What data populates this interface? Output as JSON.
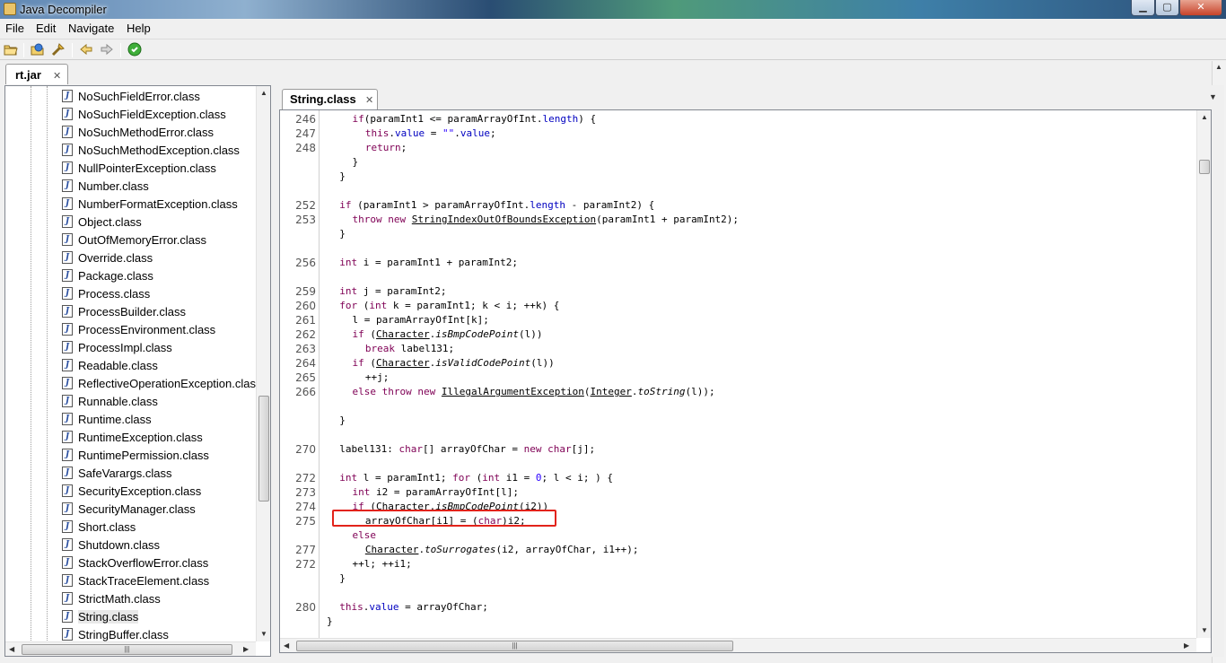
{
  "window": {
    "title": "Java Decompiler",
    "min_label": "▁",
    "max_label": "▢",
    "close_label": "✕"
  },
  "menu": [
    "File",
    "Edit",
    "Navigate",
    "Help"
  ],
  "toolbar": {
    "icons": [
      "open-file-icon",
      "open-type-icon",
      "open-type-hierarchy-icon",
      "back-icon",
      "forward-icon",
      "search-icon"
    ]
  },
  "outer_tab": {
    "label": "rt.jar",
    "close": "✕"
  },
  "inner_tab": {
    "label": "String.class",
    "close": "✕"
  },
  "tree": {
    "items": [
      "NoSuchFieldError.class",
      "NoSuchFieldException.class",
      "NoSuchMethodError.class",
      "NoSuchMethodException.class",
      "NullPointerException.class",
      "Number.class",
      "NumberFormatException.class",
      "Object.class",
      "OutOfMemoryError.class",
      "Override.class",
      "Package.class",
      "Process.class",
      "ProcessBuilder.class",
      "ProcessEnvironment.class",
      "ProcessImpl.class",
      "Readable.class",
      "ReflectiveOperationException.class",
      "Runnable.class",
      "Runtime.class",
      "RuntimeException.class",
      "RuntimePermission.class",
      "SafeVarargs.class",
      "SecurityException.class",
      "SecurityManager.class",
      "Short.class",
      "Shutdown.class",
      "StackOverflowError.class",
      "StackTraceElement.class",
      "StrictMath.class",
      "String.class",
      "StringBuffer.class"
    ],
    "selected": "String.class"
  },
  "code": {
    "lines": [
      {
        "n": "246",
        "indent": 4
      },
      {
        "n": "247",
        "indent": 6
      },
      {
        "n": "248",
        "indent": 6
      },
      {
        "n": "",
        "indent": 4
      },
      {
        "n": "",
        "indent": 2
      },
      {
        "n": "",
        "indent": 0
      },
      {
        "n": "252",
        "indent": 2
      },
      {
        "n": "253",
        "indent": 4
      },
      {
        "n": "",
        "indent": 2
      },
      {
        "n": "",
        "indent": 0
      },
      {
        "n": "256",
        "indent": 2
      },
      {
        "n": "",
        "indent": 0
      },
      {
        "n": "259",
        "indent": 2
      },
      {
        "n": "260",
        "indent": 2
      },
      {
        "n": "261",
        "indent": 4
      },
      {
        "n": "262",
        "indent": 4
      },
      {
        "n": "263",
        "indent": 6
      },
      {
        "n": "264",
        "indent": 4
      },
      {
        "n": "265",
        "indent": 6
      },
      {
        "n": "266",
        "indent": 4
      },
      {
        "n": "",
        "indent": 0
      },
      {
        "n": "",
        "indent": 2
      },
      {
        "n": "",
        "indent": 0
      },
      {
        "n": "270",
        "indent": 2
      },
      {
        "n": "",
        "indent": 0
      },
      {
        "n": "272",
        "indent": 2
      },
      {
        "n": "273",
        "indent": 4
      },
      {
        "n": "274",
        "indent": 4
      },
      {
        "n": "275",
        "indent": 6
      },
      {
        "n": "",
        "indent": 4
      },
      {
        "n": "277",
        "indent": 6
      },
      {
        "n": "272",
        "indent": 4
      },
      {
        "n": "",
        "indent": 2
      },
      {
        "n": "",
        "indent": 0
      },
      {
        "n": "280",
        "indent": 2
      },
      {
        "n": "",
        "indent": 0
      }
    ],
    "text": [
      [
        [
          "kw",
          "if"
        ],
        [
          "",
          "(paramInt1 <= paramArrayOfInt."
        ],
        [
          "fld",
          "length"
        ],
        [
          "",
          ") {"
        ]
      ],
      [
        [
          "kw",
          "this"
        ],
        [
          "",
          "."
        ],
        [
          "fld",
          "value"
        ],
        [
          "",
          " = "
        ],
        [
          "str",
          "\"\""
        ],
        [
          "",
          "."
        ],
        [
          "fld",
          "value"
        ],
        [
          "",
          ";"
        ]
      ],
      [
        [
          "kw",
          "return"
        ],
        [
          "",
          ";"
        ]
      ],
      [
        [
          "",
          "}"
        ]
      ],
      [
        [
          "",
          "}"
        ]
      ],
      [],
      [
        [
          "kw",
          "if"
        ],
        [
          "",
          " (paramInt1 > paramArrayOfInt."
        ],
        [
          "fld",
          "length"
        ],
        [
          "",
          " - paramInt2) {"
        ]
      ],
      [
        [
          "kw",
          "throw"
        ],
        [
          "",
          " "
        ],
        [
          "kw",
          "new"
        ],
        [
          "",
          " "
        ],
        [
          "ul",
          "StringIndexOutOfBoundsException"
        ],
        [
          "",
          "(paramInt1 + paramInt2);"
        ]
      ],
      [
        [
          "",
          "}"
        ]
      ],
      [],
      [
        [
          "kw",
          "int"
        ],
        [
          "",
          " i = paramInt1 + paramInt2;"
        ]
      ],
      [],
      [
        [
          "kw",
          "int"
        ],
        [
          "",
          " j = paramInt2;"
        ]
      ],
      [
        [
          "kw",
          "for"
        ],
        [
          "",
          " ("
        ],
        [
          "kw",
          "int"
        ],
        [
          "",
          " k = paramInt1; k < i; ++k) {"
        ]
      ],
      [
        [
          "",
          "l = paramArrayOfInt[k];"
        ]
      ],
      [
        [
          "kw",
          "if"
        ],
        [
          "",
          " ("
        ],
        [
          "ul",
          "Character"
        ],
        [
          "",
          "."
        ],
        [
          "it",
          "isBmpCodePoint"
        ],
        [
          "",
          "(l))"
        ]
      ],
      [
        [
          "kw",
          "break"
        ],
        [
          "",
          " label131;"
        ]
      ],
      [
        [
          "kw",
          "if"
        ],
        [
          "",
          " ("
        ],
        [
          "ul",
          "Character"
        ],
        [
          "",
          "."
        ],
        [
          "it",
          "isValidCodePoint"
        ],
        [
          "",
          "(l))"
        ]
      ],
      [
        [
          "",
          "++j;"
        ]
      ],
      [
        [
          "kw",
          "else"
        ],
        [
          "",
          " "
        ],
        [
          "kw",
          "throw"
        ],
        [
          "",
          " "
        ],
        [
          "kw",
          "new"
        ],
        [
          "",
          " "
        ],
        [
          "ul",
          "IllegalArgumentException"
        ],
        [
          "",
          "("
        ],
        [
          "ul",
          "Integer"
        ],
        [
          "",
          "."
        ],
        [
          "it",
          "toString"
        ],
        [
          "",
          "(l));"
        ]
      ],
      [],
      [
        [
          "",
          "}"
        ]
      ],
      [],
      [
        [
          "",
          "label131: "
        ],
        [
          "kw",
          "char"
        ],
        [
          "",
          "[] arrayOfChar = "
        ],
        [
          "kw",
          "new"
        ],
        [
          "",
          " "
        ],
        [
          "kw",
          "char"
        ],
        [
          "",
          "[j];"
        ]
      ],
      [],
      [
        [
          "kw",
          "int"
        ],
        [
          "",
          " l = paramInt1; "
        ],
        [
          "kw",
          "for"
        ],
        [
          "",
          " ("
        ],
        [
          "kw",
          "int"
        ],
        [
          "",
          " i1 = "
        ],
        [
          "str",
          "0"
        ],
        [
          "",
          "; l < i; ) {"
        ]
      ],
      [
        [
          "kw",
          "int"
        ],
        [
          "",
          " i2 = paramArrayOfInt[l];"
        ]
      ],
      [
        [
          "kw",
          "if"
        ],
        [
          "",
          " ("
        ],
        [
          "ul",
          "Character"
        ],
        [
          "",
          "."
        ],
        [
          "it",
          "isBmpCodePoint"
        ],
        [
          "",
          "(i2))"
        ]
      ],
      [
        [
          "",
          "arrayOfChar[i1] = ("
        ],
        [
          "kw",
          "char"
        ],
        [
          "",
          ")i2;"
        ]
      ],
      [
        [
          "kw",
          "else"
        ]
      ],
      [
        [
          "ul",
          "Character"
        ],
        [
          "",
          "."
        ],
        [
          "it",
          "toSurrogates"
        ],
        [
          "",
          "(i2, arrayOfChar, i1++);"
        ]
      ],
      [
        [
          "",
          "++l; ++i1;"
        ]
      ],
      [
        [
          "",
          "}"
        ]
      ],
      [],
      [
        [
          "kw",
          "this"
        ],
        [
          "",
          "."
        ],
        [
          "fld",
          "value"
        ],
        [
          "",
          " = arrayOfChar;"
        ]
      ],
      [
        [
          "",
          "}"
        ]
      ]
    ]
  },
  "colors": {
    "highlight_box": "#e2231a",
    "keyword": "#7f0055",
    "field": "#0000c0",
    "string": "#2a00ff"
  }
}
